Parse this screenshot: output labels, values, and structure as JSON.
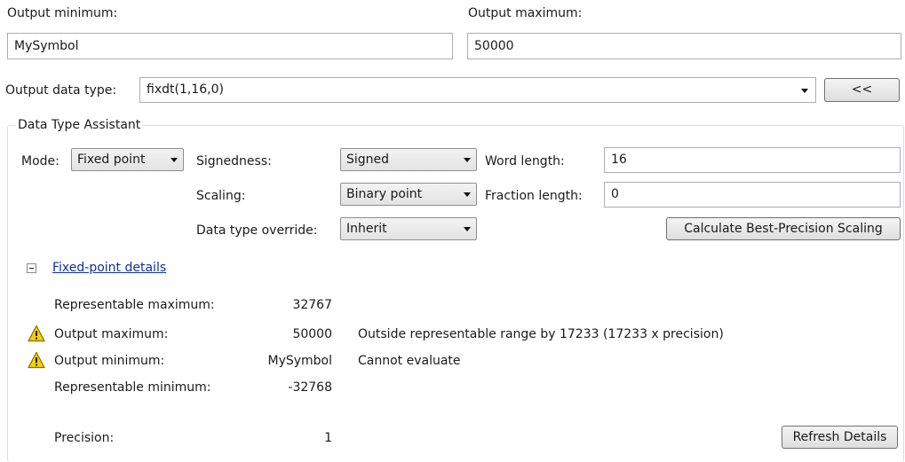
{
  "output_minimum": {
    "label": "Output minimum:",
    "value": "MySymbol"
  },
  "output_maximum": {
    "label": "Output maximum:",
    "value": "50000"
  },
  "output_data_type": {
    "label": "Output data type:",
    "value": "fixdt(1,16,0)",
    "toggle_label": "<<"
  },
  "assistant": {
    "title": "Data Type Assistant",
    "mode_label": "Mode:",
    "mode_value": "Fixed point",
    "signedness_label": "Signedness:",
    "signedness_value": "Signed",
    "word_length_label": "Word length:",
    "word_length_value": "16",
    "scaling_label": "Scaling:",
    "scaling_value": "Binary point",
    "fraction_length_label": "Fraction length:",
    "fraction_length_value": "0",
    "override_label": "Data type override:",
    "override_value": "Inherit",
    "calc_button": "Calculate Best-Precision Scaling"
  },
  "details": {
    "link": "Fixed-point details",
    "rows": [
      {
        "label": "Representable maximum:",
        "value": "32767",
        "message": "",
        "warning": false
      },
      {
        "label": "Output maximum:",
        "value": "50000",
        "message": "Outside representable range by 17233 (17233 x precision)",
        "warning": true
      },
      {
        "label": "Output minimum:",
        "value": "MySymbol",
        "message": "Cannot evaluate",
        "warning": true
      },
      {
        "label": "Representable minimum:",
        "value": "-32768",
        "message": "",
        "warning": false
      }
    ],
    "precision_label": "Precision:",
    "precision_value": "1",
    "refresh_button": "Refresh Details"
  },
  "icons": {
    "warning": "warning-icon",
    "collapse": "collapse-minus-icon",
    "dropdown": "chevron-down-icon"
  },
  "colors": {
    "link": "#0b2fa8",
    "warning_fill": "#f5d000"
  }
}
